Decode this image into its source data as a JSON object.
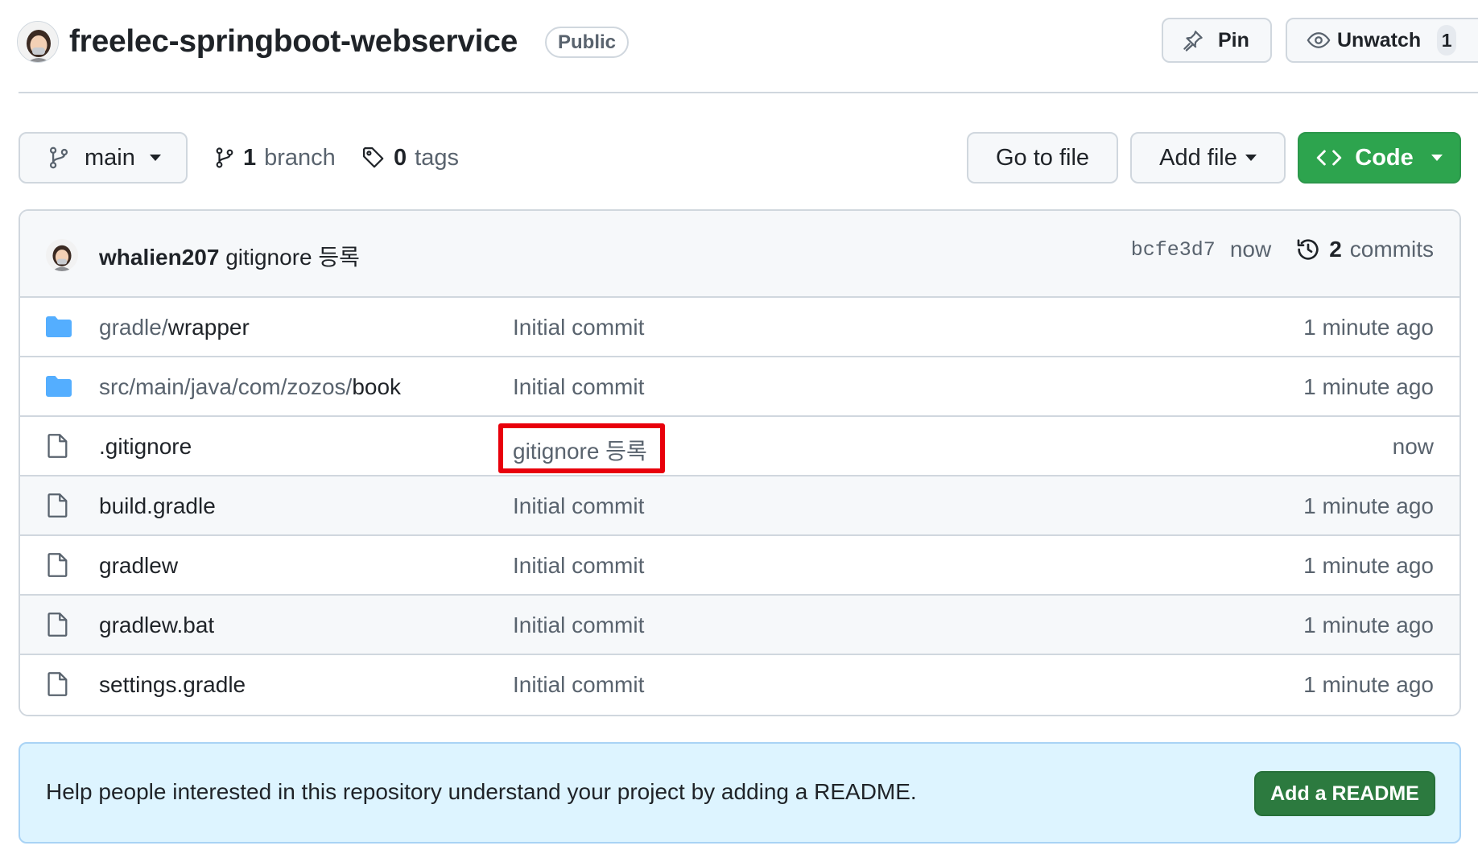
{
  "repo": {
    "name": "freelec-springboot-webservice",
    "visibility": "Public"
  },
  "actions": {
    "pin_label": "Pin",
    "watch_label": "Unwatch",
    "watch_count": "1"
  },
  "toolbar": {
    "branch": "main",
    "branch_count": "1",
    "branch_label": "branch",
    "tag_count": "0",
    "tag_label": "tags",
    "go_to_file": "Go to file",
    "add_file": "Add file",
    "code": "Code"
  },
  "latest_commit": {
    "author": "whalien207",
    "message": "gitignore 등록",
    "sha": "bcfe3d7",
    "time": "now",
    "commit_count": "2",
    "commit_label": "commits"
  },
  "files": [
    {
      "type": "folder",
      "name_prefix": "gradle/",
      "name": "wrapper",
      "message": "Initial commit",
      "age": "1 minute ago"
    },
    {
      "type": "folder",
      "name_prefix": "src/main/java/com/zozos/",
      "name": "book",
      "message": "Initial commit",
      "age": "1 minute ago"
    },
    {
      "type": "file",
      "name_prefix": "",
      "name": ".gitignore",
      "message": "gitignore 등록",
      "age": "now"
    },
    {
      "type": "file",
      "name_prefix": "",
      "name": "build.gradle",
      "message": "Initial commit",
      "age": "1 minute ago"
    },
    {
      "type": "file",
      "name_prefix": "",
      "name": "gradlew",
      "message": "Initial commit",
      "age": "1 minute ago"
    },
    {
      "type": "file",
      "name_prefix": "",
      "name": "gradlew.bat",
      "message": "Initial commit",
      "age": "1 minute ago"
    },
    {
      "type": "file",
      "name_prefix": "",
      "name": "settings.gradle",
      "message": "Initial commit",
      "age": "1 minute ago"
    }
  ],
  "readme": {
    "text": "Help people interested in this repository understand your project by adding a README.",
    "button": "Add a README"
  },
  "colors": {
    "primary_green": "#2da44e",
    "readme_green": "#2c7a3f",
    "folder_blue": "#54aeff",
    "highlight_red": "#e8000b",
    "banner_blue": "#ddf4ff"
  }
}
